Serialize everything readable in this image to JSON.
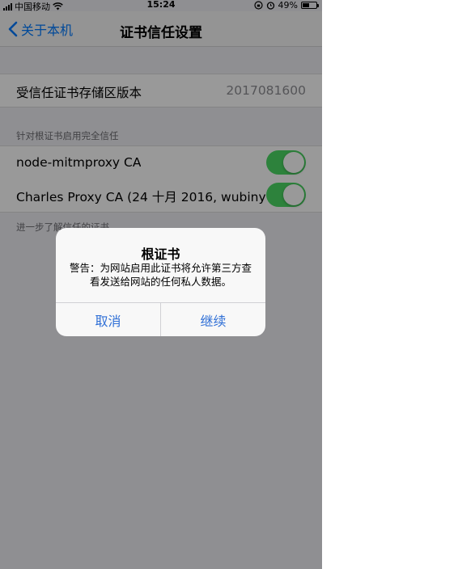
{
  "status_bar": {
    "carrier": "中国移动",
    "time": "15:24",
    "battery": "49%",
    "battery_level": 0.49
  },
  "nav": {
    "back_label": "关于本机",
    "title": "证书信任设置"
  },
  "store_version": {
    "label": "受信任证书存储区版本",
    "value": "2017081600"
  },
  "trust_section": {
    "header": "针对根证书启用完全信任",
    "footer": "进一步了解信任的证书",
    "items": [
      {
        "label": "node-mitmproxy CA",
        "enabled": true
      },
      {
        "label": "Charles Proxy CA (24 十月 2016, wubinyao...",
        "enabled": true
      }
    ]
  },
  "alert": {
    "title": "根证书",
    "message": "警告：为网站启用此证书将允许第三方查看发送给网站的任何私人数据。",
    "cancel_label": "取消",
    "continue_label": "继续"
  },
  "colors": {
    "toggle_on": "#4cd964",
    "tint": "#007aff",
    "alert_button": "#2f6fd6"
  },
  "icons": {
    "back": "chevron-left-icon",
    "wifi": "wifi-icon",
    "rotation_lock": "rotation-lock-icon",
    "alarm": "alarm-icon",
    "battery": "battery-icon"
  }
}
